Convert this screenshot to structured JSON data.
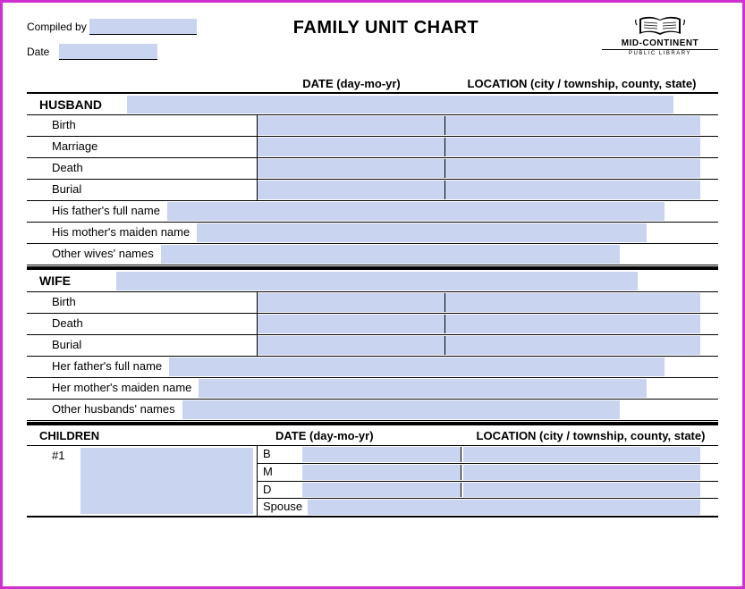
{
  "header": {
    "compiled_by_label": "Compiled by",
    "compiled_by_value": "",
    "date_label": "Date",
    "date_value": "",
    "title": "FAMILY UNIT CHART",
    "org_name": "MID-CONTINENT",
    "org_sub": "PUBLIC LIBRARY"
  },
  "columns": {
    "date": "DATE (day-mo-yr)",
    "location": "LOCATION (city / township, county, state)"
  },
  "husband": {
    "section": "HUSBAND",
    "name": "",
    "birth_label": "Birth",
    "birth_date": "",
    "birth_loc": "",
    "marriage_label": "Marriage",
    "marriage_date": "",
    "marriage_loc": "",
    "death_label": "Death",
    "death_date": "",
    "death_loc": "",
    "burial_label": "Burial",
    "burial_date": "",
    "burial_loc": "",
    "father_label": "His father's full name",
    "father": "",
    "mother_label": "His mother's maiden name",
    "mother": "",
    "other_label": "Other wives' names",
    "other": ""
  },
  "wife": {
    "section": "WIFE",
    "name": "",
    "birth_label": "Birth",
    "birth_date": "",
    "birth_loc": "",
    "death_label": "Death",
    "death_date": "",
    "death_loc": "",
    "burial_label": "Burial",
    "burial_date": "",
    "burial_loc": "",
    "father_label": "Her father's full name",
    "father": "",
    "mother_label": "Her mother's maiden name",
    "mother": "",
    "other_label": "Other husbands' names",
    "other": ""
  },
  "children": {
    "section": "CHILDREN",
    "date_col": "DATE (day-mo-yr)",
    "loc_col": "LOCATION (city / township, county, state)",
    "items": [
      {
        "num": "#1",
        "name": "",
        "b": "B",
        "b_date": "",
        "b_loc": "",
        "m": "M",
        "m_date": "",
        "m_loc": "",
        "d": "D",
        "d_date": "",
        "d_loc": "",
        "spouse_label": "Spouse",
        "spouse": ""
      }
    ]
  }
}
